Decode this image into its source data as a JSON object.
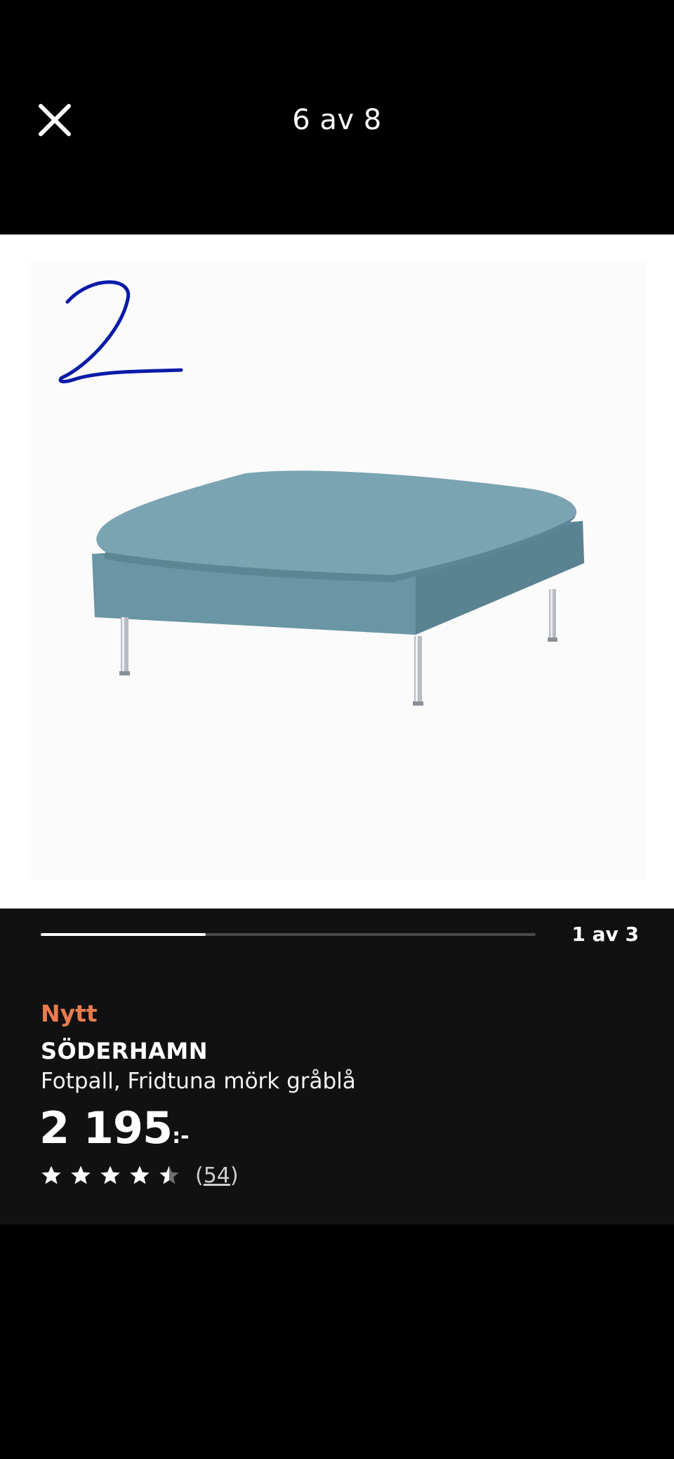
{
  "header": {
    "title": "6 av 8",
    "close_icon": "close-icon"
  },
  "image": {
    "annotation": "2",
    "annotation_color": "#0a1aa8",
    "product_color": "#6d97a6"
  },
  "carousel": {
    "progress_fraction": 0.333,
    "label": "1 av 3"
  },
  "product": {
    "badge": "Nytt",
    "badge_color": "#e87c4f",
    "name": "SÖDERHAMN",
    "description": "Fotpall, Fridtuna mörk gråblå",
    "price": "2 195",
    "price_suffix": ":-",
    "rating": {
      "stars": 4.5,
      "max": 5,
      "count_open": "(",
      "count": "54",
      "count_close": ")"
    }
  }
}
